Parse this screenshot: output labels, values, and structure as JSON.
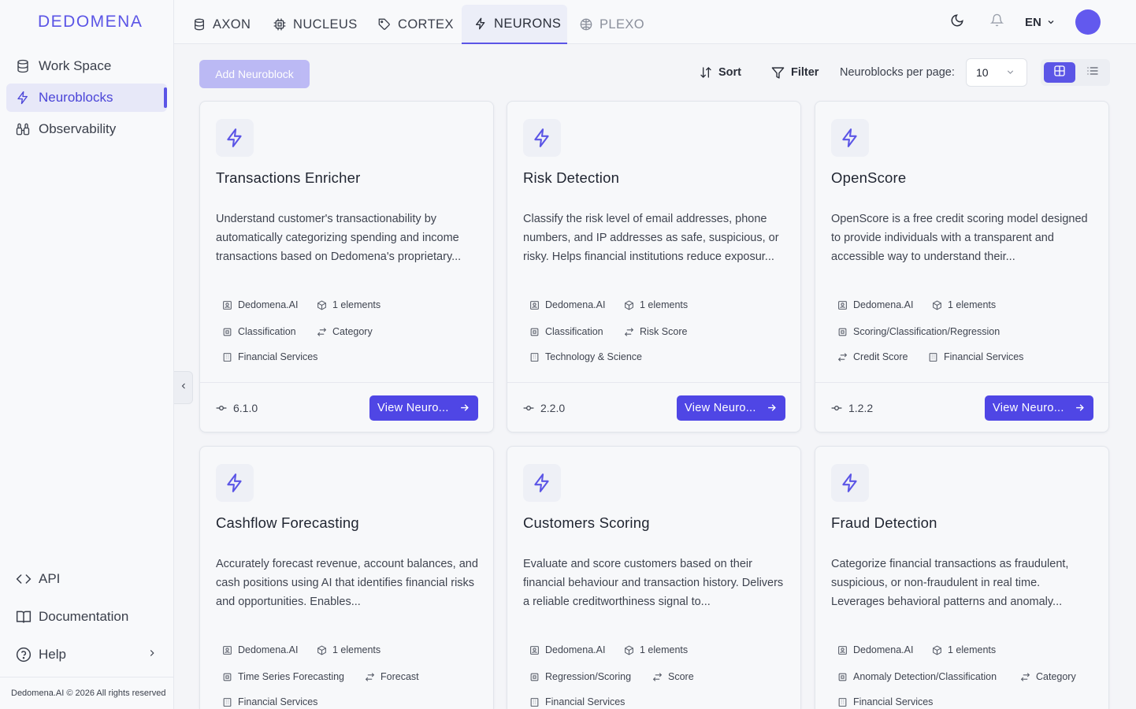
{
  "app": {
    "logo": "DEDOMENA"
  },
  "sidebar": {
    "items": [
      {
        "label": "Work Space",
        "icon": "database-icon",
        "active": false
      },
      {
        "label": "Neuroblocks",
        "icon": "bolt-icon",
        "active": true
      },
      {
        "label": "Observability",
        "icon": "binoculars-icon",
        "active": false
      }
    ],
    "bottom": [
      {
        "label": "API",
        "icon": "code-icon"
      },
      {
        "label": "Documentation",
        "icon": "book-icon"
      },
      {
        "label": "Help",
        "icon": "help-circle-icon"
      }
    ],
    "copyright": "Dedomena.AI © 2026 All rights reserved"
  },
  "topnav": {
    "tabs": [
      {
        "label": "AXON",
        "icon": "database-icon",
        "active": false
      },
      {
        "label": "NUCLEUS",
        "icon": "chip-icon",
        "active": false
      },
      {
        "label": "CORTEX",
        "icon": "tag-icon",
        "active": false
      },
      {
        "label": "NEURONS",
        "icon": "bolt-icon",
        "active": true
      },
      {
        "label": "PLEXO",
        "icon": "network-icon",
        "active": false
      }
    ],
    "language": "EN"
  },
  "toolbar": {
    "add_label": "Add Neuroblock",
    "sort_label": "Sort",
    "filter_label": "Filter",
    "per_page_label": "Neuroblocks per page:",
    "per_page_value": "10"
  },
  "colors": {
    "accent": "#4f46e5",
    "accent_light": "#b9b6f4",
    "avatar": "#6259ee"
  },
  "cards": [
    {
      "title": "Transactions Enricher",
      "description": "Understand customer's transactionability by automatically categorizing spending and income transactions based on Dedomena's proprietary...",
      "provider": "Dedomena.AI",
      "elements": "1 elements",
      "task": "Classification",
      "output": "Category",
      "industry": "Financial Services",
      "version": "6.1.0",
      "button": "View Neuro..."
    },
    {
      "title": "Risk Detection",
      "description": "Classify the risk level of email addresses, phone numbers, and IP addresses as safe, suspicious, or risky. Helps financial institutions reduce exposur...",
      "provider": "Dedomena.AI",
      "elements": "1 elements",
      "task": "Classification",
      "output": "Risk Score",
      "industry": "Technology & Science",
      "version": "2.2.0",
      "button": "View Neuro..."
    },
    {
      "title": "OpenScore",
      "description": "OpenScore is a free credit scoring model designed to provide individuals with a transparent and accessible way to understand their...",
      "provider": "Dedomena.AI",
      "elements": "1 elements",
      "task": "Scoring/Classification/Regression",
      "output": "Credit Score",
      "industry": "Financial Services",
      "version": "1.2.2",
      "button": "View Neuro..."
    },
    {
      "title": "Cashflow Forecasting",
      "description": "Accurately forecast revenue, account balances, and cash positions using AI that identifies financial risks and opportunities. Enables...",
      "provider": "Dedomena.AI",
      "elements": "1 elements",
      "task": "Time Series Forecasting",
      "output": "Forecast",
      "industry": "Financial Services",
      "version": "",
      "button": ""
    },
    {
      "title": "Customers Scoring",
      "description": "Evaluate and score customers based on their financial behaviour and transaction history. Delivers a reliable creditworthiness signal to...",
      "provider": "Dedomena.AI",
      "elements": "1 elements",
      "task": "Regression/Scoring",
      "output": "Score",
      "industry": "Financial Services",
      "version": "",
      "button": ""
    },
    {
      "title": "Fraud Detection",
      "description": "Categorize financial transactions as fraudulent, suspicious, or non-fraudulent in real time. Leverages behavioral patterns and anomaly...",
      "provider": "Dedomena.AI",
      "elements": "1 elements",
      "task": "Anomaly Detection/Classification",
      "output": "Category",
      "industry": "Financial Services",
      "version": "",
      "button": ""
    }
  ]
}
